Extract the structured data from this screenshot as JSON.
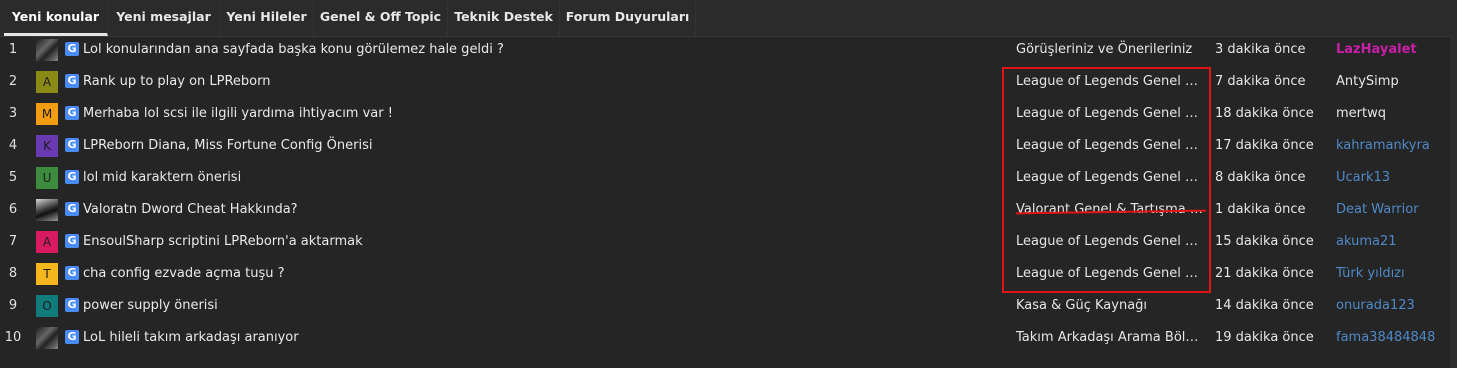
{
  "tabs": [
    {
      "label": "Yeni konular",
      "active": true
    },
    {
      "label": "Yeni mesajlar",
      "active": false
    },
    {
      "label": "Yeni Hileler",
      "active": false
    },
    {
      "label": "Genel & Off Topic",
      "active": false
    },
    {
      "label": "Teknik Destek",
      "active": false
    },
    {
      "label": "Forum Duyuruları",
      "active": false
    }
  ],
  "colors": {
    "background": "#252525",
    "tab_bar": "#2b2b2b",
    "link_blue": "#4f89c7",
    "username_magenta": "#c81fa8",
    "annotation_red": "#e01414",
    "g_icon_blue": "#4a8cf7"
  },
  "rows": [
    {
      "num": "1",
      "avatar": {
        "type": "image",
        "letter": "",
        "color": ""
      },
      "prefix_icon": "G",
      "title": "Lol konularından ana sayfada başka konu görülemez hale geldi ?",
      "forum": "Görüşleriniz ve Önerileriniz",
      "time": "3 dakika önce",
      "user": "LazHayalet",
      "user_color": "#c81fa8",
      "user_bold": true
    },
    {
      "num": "2",
      "avatar": {
        "type": "letter",
        "letter": "A",
        "color": "#8c8a16"
      },
      "prefix_icon": "G",
      "title": "Rank up to play on LPReborn",
      "forum": "League of Legends Genel & Tartışma Bölümü",
      "time": "7 dakika önce",
      "user": "AntySimp",
      "user_color": "#e6e6e6",
      "user_bold": false
    },
    {
      "num": "3",
      "avatar": {
        "type": "letter",
        "letter": "M",
        "color": "#f39c12"
      },
      "prefix_icon": "G",
      "title": "Merhaba lol scsi ile ilgili yardıma ihtiyacım var !",
      "forum": "League of Legends Genel & Tartışma Bölümü",
      "time": "18 dakika önce",
      "user": "mertwq",
      "user_color": "#e6e6e6",
      "user_bold": false
    },
    {
      "num": "4",
      "avatar": {
        "type": "letter",
        "letter": "K",
        "color": "#6a3ab2"
      },
      "prefix_icon": "G",
      "title": "LPReborn Diana, Miss Fortune Config Önerisi",
      "forum": "League of Legends Genel & Tartışma Bölümü",
      "time": "17 dakika önce",
      "user": "kahramankyra",
      "user_color": "#4f89c7",
      "user_bold": false
    },
    {
      "num": "5",
      "avatar": {
        "type": "letter",
        "letter": "U",
        "color": "#3d8b3d"
      },
      "prefix_icon": "G",
      "title": "lol mid karaktern önerisi",
      "forum": "League of Legends Genel & Tartışma Bölümü",
      "time": "8 dakika önce",
      "user": "Ucark13",
      "user_color": "#4f89c7",
      "user_bold": false
    },
    {
      "num": "6",
      "avatar": {
        "type": "image2",
        "letter": "",
        "color": ""
      },
      "prefix_icon": "G",
      "title": "Valoratn Dword Cheat Hakkında?",
      "forum": "Valorant Genel & Tartışma Bölümü",
      "time": "1 dakika önce",
      "user": "Deat Warrior",
      "user_color": "#4f89c7",
      "user_bold": false
    },
    {
      "num": "7",
      "avatar": {
        "type": "letter",
        "letter": "A",
        "color": "#d81b60"
      },
      "prefix_icon": "G",
      "title": "EnsoulSharp scriptini LPReborn'a aktarmak",
      "forum": "League of Legends Genel & Tartışma Bölümü",
      "time": "15 dakika önce",
      "user": "akuma21",
      "user_color": "#4f89c7",
      "user_bold": false
    },
    {
      "num": "8",
      "avatar": {
        "type": "letter",
        "letter": "T",
        "color": "#f6b71e"
      },
      "prefix_icon": "G",
      "title": "cha config ezvade açma tuşu ?",
      "forum": "League of Legends Genel & Tartışma Bölümü",
      "time": "21 dakika önce",
      "user": "Türk yıldızı",
      "user_color": "#4f89c7",
      "user_bold": false
    },
    {
      "num": "9",
      "avatar": {
        "type": "letter",
        "letter": "O",
        "color": "#117a7a"
      },
      "prefix_icon": "G",
      "title": "power supply önerisi",
      "forum": "Kasa & Güç Kaynağı",
      "time": "14 dakika önce",
      "user": "onurada123",
      "user_color": "#4f89c7",
      "user_bold": false
    },
    {
      "num": "10",
      "avatar": {
        "type": "image",
        "letter": "",
        "color": ""
      },
      "prefix_icon": "G",
      "title": "LoL hileli takım arkadaşı aranıyor",
      "forum": "Takım Arkadaşı Arama Bölümü",
      "time": "19 dakika önce",
      "user": "fama38484848",
      "user_color": "#4f89c7",
      "user_bold": false
    }
  ]
}
